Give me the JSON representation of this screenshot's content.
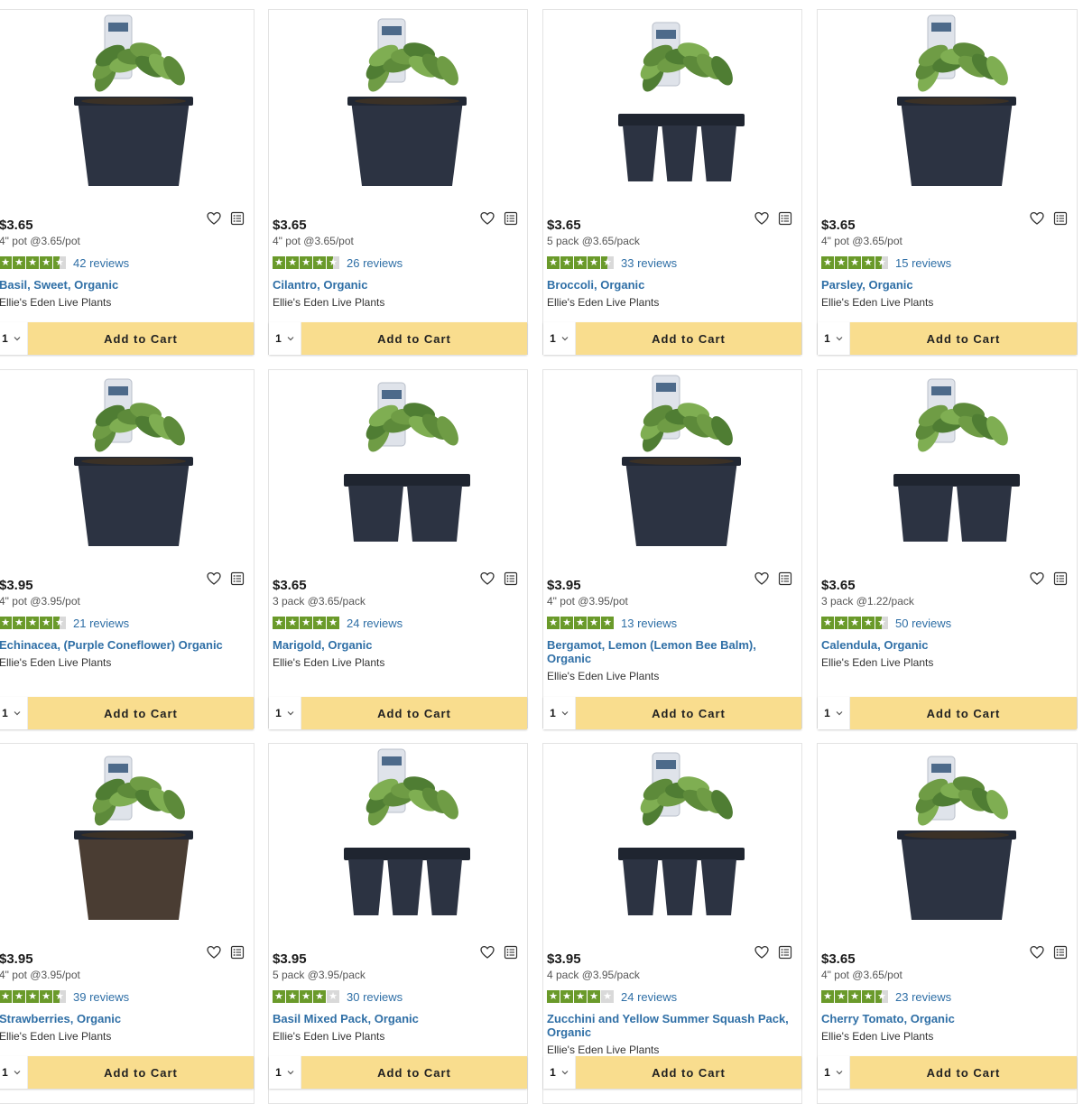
{
  "colors": {
    "accent_link": "#2f6fa6",
    "star_fill": "#6a9a2a",
    "star_empty": "#d9d9d9",
    "cart_button": "#f9dd8e"
  },
  "icons": {
    "wishlist": "heart-icon",
    "list": "list-icon",
    "quantity": "chevron-down-icon"
  },
  "products": [
    {
      "price": "$3.65",
      "unit": "4\" pot @3.65/pot",
      "rating": 4.5,
      "reviews": "42 reviews",
      "name": "Basil, Sweet, Organic",
      "brand": "Ellie's Eden Live Plants",
      "qty": "1",
      "add_label": "Add to Cart"
    },
    {
      "price": "$3.65",
      "unit": "4\" pot @3.65/pot",
      "rating": 4.5,
      "reviews": "26 reviews",
      "name": "Cilantro, Organic",
      "brand": "Ellie's Eden Live Plants",
      "qty": "1",
      "add_label": "Add to Cart"
    },
    {
      "price": "$3.65",
      "unit": "5 pack @3.65/pack",
      "rating": 4.5,
      "reviews": "33 reviews",
      "name": "Broccoli, Organic",
      "brand": "Ellie's Eden Live Plants",
      "qty": "1",
      "add_label": "Add to Cart"
    },
    {
      "price": "$3.65",
      "unit": "4\" pot @3.65/pot",
      "rating": 4.5,
      "reviews": "15 reviews",
      "name": "Parsley, Organic",
      "brand": "Ellie's Eden Live Plants",
      "qty": "1",
      "add_label": "Add to Cart"
    },
    {
      "price": "$3.95",
      "unit": "4\" pot @3.95/pot",
      "rating": 4.5,
      "reviews": "21 reviews",
      "name": "Echinacea, (Purple Coneflower) Organic",
      "brand": "Ellie's Eden Live Plants",
      "qty": "1",
      "add_label": "Add to Cart"
    },
    {
      "price": "$3.65",
      "unit": "3 pack @3.65/pack",
      "rating": 5,
      "reviews": "24 reviews",
      "name": "Marigold, Organic",
      "brand": "Ellie's Eden Live Plants",
      "qty": "1",
      "add_label": "Add to Cart"
    },
    {
      "price": "$3.95",
      "unit": "4\" pot @3.95/pot",
      "rating": 5,
      "reviews": "13 reviews",
      "name": "Bergamot, Lemon (Lemon Bee Balm), Organic",
      "brand": "Ellie's Eden Live Plants",
      "qty": "1",
      "add_label": "Add to Cart"
    },
    {
      "price": "$3.65",
      "unit": "3 pack @1.22/pack",
      "rating": 4.5,
      "reviews": "50 reviews",
      "name": "Calendula, Organic",
      "brand": "Ellie's Eden Live Plants",
      "qty": "1",
      "add_label": "Add to Cart"
    },
    {
      "price": "$3.95",
      "unit": "4\" pot @3.95/pot",
      "rating": 4.5,
      "reviews": "39 reviews",
      "name": "Strawberries, Organic",
      "brand": "Ellie's Eden Live Plants",
      "qty": "1",
      "add_label": "Add to Cart"
    },
    {
      "price": "$3.95",
      "unit": "5 pack @3.95/pack",
      "rating": 4,
      "reviews": "30 reviews",
      "name": "Basil Mixed Pack, Organic",
      "brand": "Ellie's Eden Live Plants",
      "qty": "1",
      "add_label": "Add to Cart"
    },
    {
      "price": "$3.95",
      "unit": "4 pack @3.95/pack",
      "rating": 4,
      "reviews": "24 reviews",
      "name": "Zucchini and Yellow Summer Squash Pack, Organic",
      "brand": "Ellie's Eden Live Plants",
      "qty": "1",
      "add_label": "Add to Cart"
    },
    {
      "price": "$3.65",
      "unit": "4\" pot @3.65/pot",
      "rating": 4.5,
      "reviews": "23 reviews",
      "name": "Cherry Tomato, Organic",
      "brand": "Ellie's Eden Live Plants",
      "qty": "1",
      "add_label": "Add to Cart"
    }
  ]
}
